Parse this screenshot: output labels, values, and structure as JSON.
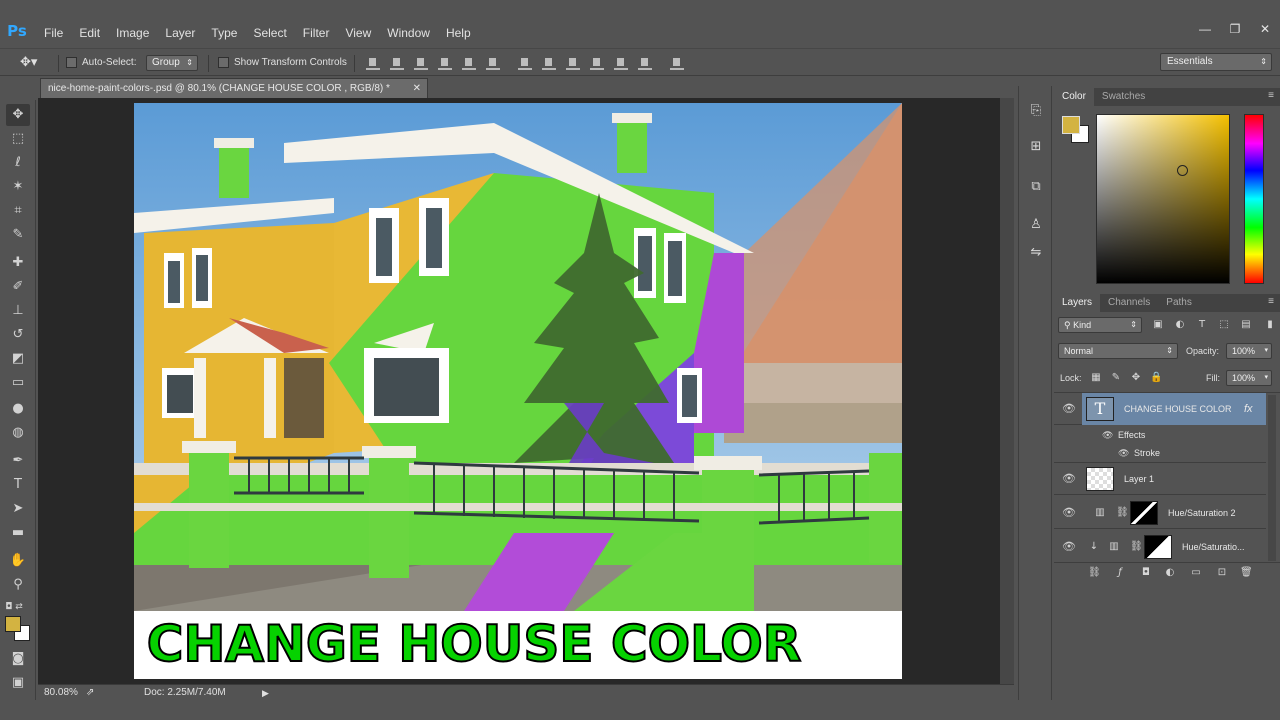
{
  "app": {
    "logo": "Ps"
  },
  "menu": [
    "File",
    "Edit",
    "Image",
    "Layer",
    "Type",
    "Select",
    "Filter",
    "View",
    "Window",
    "Help"
  ],
  "window_buttons": [
    "—",
    "❐",
    "✕"
  ],
  "options": {
    "auto_select_label": "Auto-Select:",
    "auto_select_value": "Group",
    "show_transform_label": "Show Transform Controls"
  },
  "workspace": "Essentials",
  "document": {
    "tab_title": "nice-home-paint-colors-.psd @ 80.1% (CHANGE HOUSE COLOR , RGB/8) *",
    "caption": "CHANGE HOUSE COLOR"
  },
  "status": {
    "zoom": "80.08%",
    "doc": "Doc: 2.25M/7.40M"
  },
  "color_panel": {
    "tabs": [
      "Color",
      "Swatches"
    ],
    "fg_color": "#d3b341",
    "bg_color": "#ffffff"
  },
  "layers_panel": {
    "tabs": [
      "Layers",
      "Channels",
      "Paths"
    ],
    "kind_label": "Kind",
    "blend_mode": "Normal",
    "opacity_label": "Opacity:",
    "opacity_value": "100%",
    "lock_label": "Lock:",
    "fill_label": "Fill:",
    "fill_value": "100%",
    "layers": [
      {
        "name": "CHANGE HOUSE COLOR",
        "kind": "text",
        "fx": "fx"
      },
      {
        "name": "Effects",
        "kind": "effects"
      },
      {
        "name": "Stroke",
        "kind": "effect"
      },
      {
        "name": "Layer 1",
        "kind": "pixel"
      },
      {
        "name": "Hue/Saturation 2",
        "kind": "adjustment"
      },
      {
        "name": "Hue/Saturatio...",
        "kind": "adjustment"
      }
    ]
  }
}
